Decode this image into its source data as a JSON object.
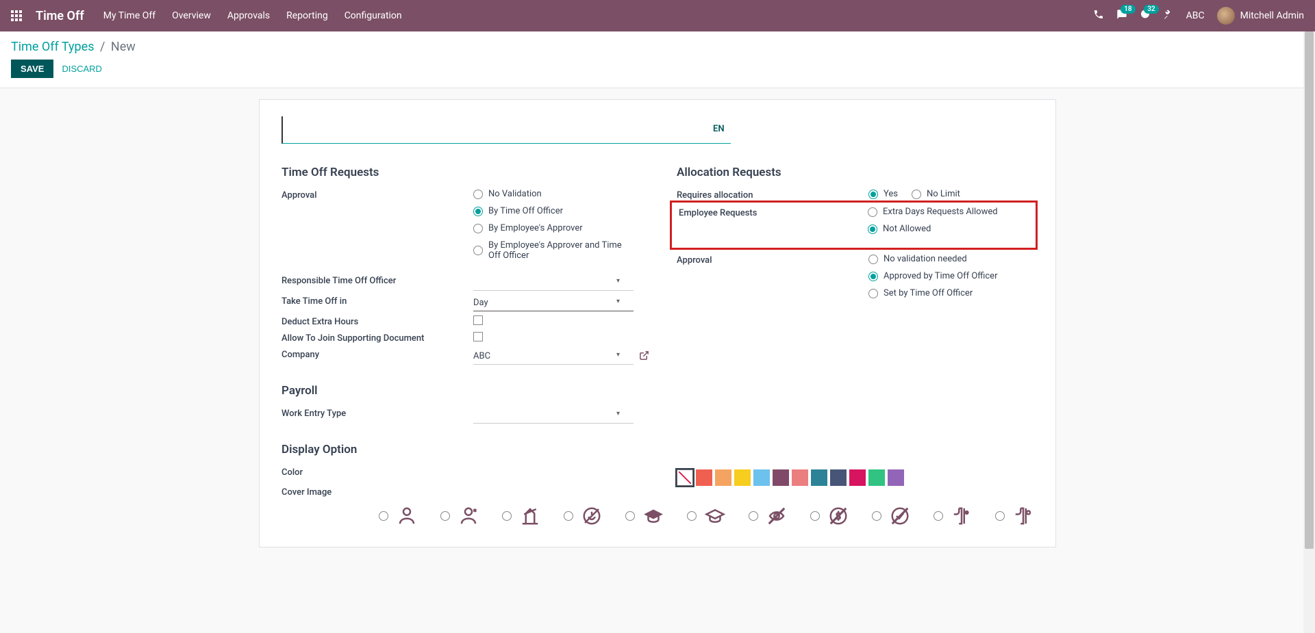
{
  "navbar": {
    "brand": "Time Off",
    "menu": [
      "My Time Off",
      "Overview",
      "Approvals",
      "Reporting",
      "Configuration"
    ],
    "msg_badge": "18",
    "activity_badge": "32",
    "company": "ABC",
    "user": "Mitchell Admin"
  },
  "breadcrumb": {
    "root": "Time Off Types",
    "current": "New"
  },
  "actions": {
    "save": "SAVE",
    "discard": "DISCARD"
  },
  "lang": "EN",
  "sections": {
    "timeoff_req": "Time Off Requests",
    "alloc_req": "Allocation Requests",
    "payroll": "Payroll",
    "display": "Display Option"
  },
  "labels": {
    "approval": "Approval",
    "resp_officer": "Responsible Time Off Officer",
    "take_in": "Take Time Off in",
    "deduct": "Deduct Extra Hours",
    "allow_join": "Allow To Join Supporting Document",
    "company": "Company",
    "work_entry": "Work Entry Type",
    "color": "Color",
    "cover": "Cover Image",
    "req_alloc": "Requires allocation",
    "emp_req": "Employee Requests",
    "alloc_approval": "Approval"
  },
  "radios": {
    "approval": [
      "No Validation",
      "By Time Off Officer",
      "By Employee's Approver",
      "By Employee's Approver and Time Off Officer"
    ],
    "req_alloc": [
      "Yes",
      "No Limit"
    ],
    "emp_req": [
      "Extra Days Requests Allowed",
      "Not Allowed"
    ],
    "alloc_approval": [
      "No validation needed",
      "Approved by Time Off Officer",
      "Set by Time Off Officer"
    ]
  },
  "values": {
    "take_in": "Day",
    "company": "ABC"
  },
  "colors": [
    "#f06050",
    "#f4a460",
    "#f7cd1f",
    "#6cc1ed",
    "#814968",
    "#eb7e7f",
    "#2c8397",
    "#475577",
    "#d6145f",
    "#30c381",
    "#9365b8"
  ]
}
